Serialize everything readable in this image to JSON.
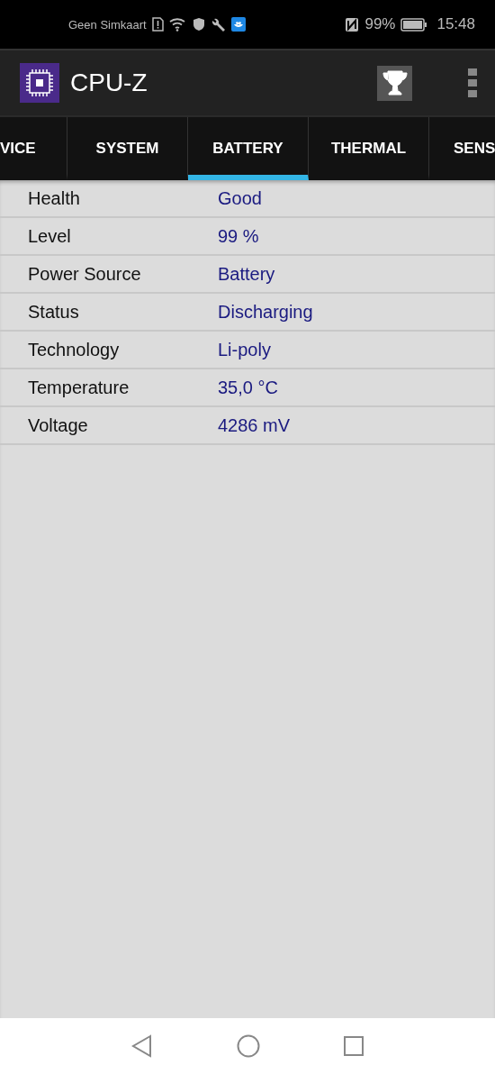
{
  "status_bar": {
    "carrier": "Geen Simkaart",
    "battery": "99%",
    "time": "15:48"
  },
  "app_bar": {
    "title": "CPU-Z"
  },
  "tabs": [
    {
      "label": "VICE",
      "selected": false
    },
    {
      "label": "SYSTEM",
      "selected": false
    },
    {
      "label": "BATTERY",
      "selected": true
    },
    {
      "label": "THERMAL",
      "selected": false
    },
    {
      "label": "SENS",
      "selected": false
    }
  ],
  "rows": [
    {
      "label": "Health",
      "value": "Good"
    },
    {
      "label": "Level",
      "value": "99 %"
    },
    {
      "label": "Power Source",
      "value": "Battery"
    },
    {
      "label": "Status",
      "value": "Discharging"
    },
    {
      "label": "Technology",
      "value": "Li-poly"
    },
    {
      "label": "Temperature",
      "value": "35,0 °C"
    },
    {
      "label": "Voltage",
      "value": "4286 mV"
    }
  ]
}
